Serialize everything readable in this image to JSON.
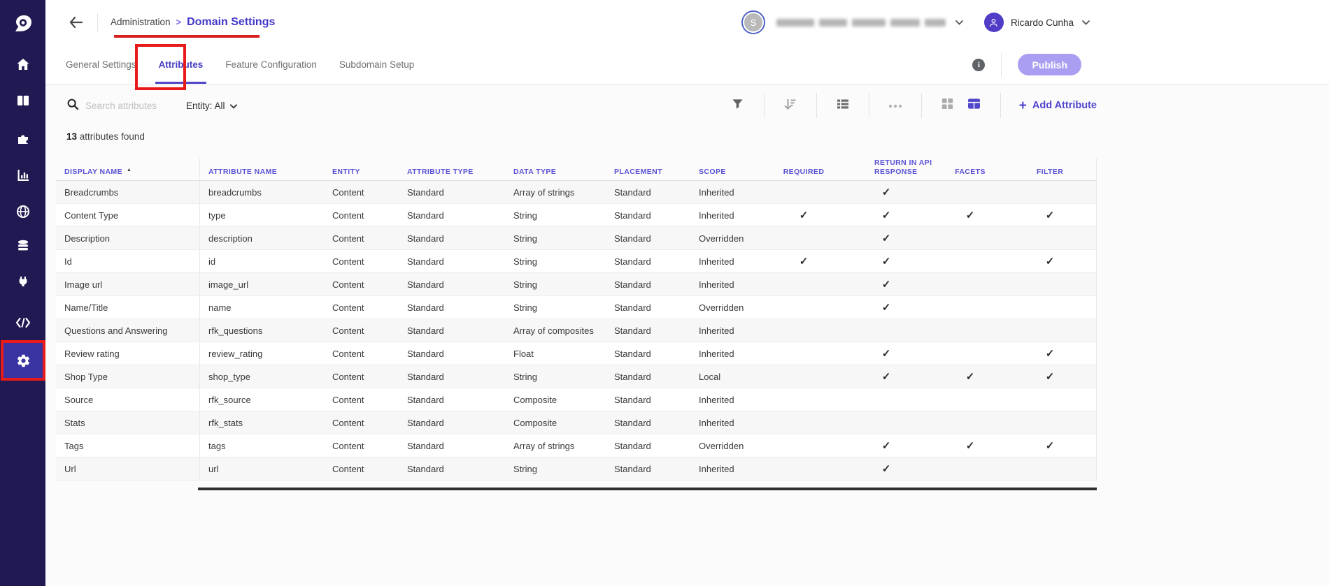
{
  "colors": {
    "accent": "#4f46c8",
    "sidebar_bg": "#211a52",
    "annotation_red": "#e81a1a",
    "publish_bg": "#a99ef2"
  },
  "sidebar": {
    "logo_icon": "discover-logo-icon",
    "item_icons": [
      "home-icon",
      "columns-icon",
      "puzzle-icon",
      "bar-chart-icon",
      "globe-icon",
      "database-icon",
      "plug-icon",
      "code-icon",
      "gear-icon"
    ],
    "active_item": "gear-icon"
  },
  "topbar": {
    "back_icon": "arrow-left-icon",
    "breadcrumb": {
      "parent": "Administration",
      "separator": ">",
      "current": "Domain Settings"
    },
    "workspace": {
      "avatar_initial": "S",
      "name_redacted": true
    },
    "user": {
      "name": "Ricardo Cunha"
    }
  },
  "tabs": {
    "items": [
      {
        "label": "General Settings",
        "active": false
      },
      {
        "label": "Attributes",
        "active": true
      },
      {
        "label": "Feature Configuration",
        "active": false
      },
      {
        "label": "Subdomain Setup",
        "active": false
      }
    ]
  },
  "actions": {
    "info_icon": "i",
    "publish_label": "Publish"
  },
  "toolbar": {
    "search_placeholder": "Search attributes",
    "entity_label": "Entity: All",
    "icons": [
      "filter-funnel-icon",
      "sort-icon",
      "list-view-icon",
      "more-ellipsis-icon",
      "grid-view-icon",
      "table-view-icon"
    ],
    "active_view": "table-view-icon",
    "add_attribute_plus": "+",
    "add_attribute_label": "Add Attribute"
  },
  "summary": {
    "count": "13",
    "label": "attributes found"
  },
  "table": {
    "check_glyph": "✓",
    "sort_arrow": "▲",
    "columns": [
      {
        "key": "display_name",
        "label": "DISPLAY NAME",
        "type": "text",
        "sorted": true
      },
      {
        "key": "attribute_name",
        "label": "ATTRIBUTE NAME",
        "type": "text"
      },
      {
        "key": "entity",
        "label": "ENTITY",
        "type": "text"
      },
      {
        "key": "attribute_type",
        "label": "ATTRIBUTE TYPE",
        "type": "text"
      },
      {
        "key": "data_type",
        "label": "DATA TYPE",
        "type": "text"
      },
      {
        "key": "placement",
        "label": "PLACEMENT",
        "type": "text"
      },
      {
        "key": "scope",
        "label": "SCOPE",
        "type": "text"
      },
      {
        "key": "required",
        "label": "REQUIRED",
        "type": "check"
      },
      {
        "key": "return_in_api_response",
        "label": "RETURN IN API RESPONSE",
        "type": "check"
      },
      {
        "key": "facets",
        "label": "FACETS",
        "type": "check"
      },
      {
        "key": "filter",
        "label": "FILTER",
        "type": "check"
      }
    ],
    "rows": [
      {
        "display_name": "Breadcrumbs",
        "attribute_name": "breadcrumbs",
        "entity": "Content",
        "attribute_type": "Standard",
        "data_type": "Array of strings",
        "placement": "Standard",
        "scope": "Inherited",
        "required": false,
        "return_in_api_response": true,
        "facets": false,
        "filter": false
      },
      {
        "display_name": "Content Type",
        "attribute_name": "type",
        "entity": "Content",
        "attribute_type": "Standard",
        "data_type": "String",
        "placement": "Standard",
        "scope": "Inherited",
        "required": true,
        "return_in_api_response": true,
        "facets": true,
        "filter": true
      },
      {
        "display_name": "Description",
        "attribute_name": "description",
        "entity": "Content",
        "attribute_type": "Standard",
        "data_type": "String",
        "placement": "Standard",
        "scope": "Overridden",
        "required": false,
        "return_in_api_response": true,
        "facets": false,
        "filter": false
      },
      {
        "display_name": "Id",
        "attribute_name": "id",
        "entity": "Content",
        "attribute_type": "Standard",
        "data_type": "String",
        "placement": "Standard",
        "scope": "Inherited",
        "required": true,
        "return_in_api_response": true,
        "facets": false,
        "filter": true
      },
      {
        "display_name": "Image url",
        "attribute_name": "image_url",
        "entity": "Content",
        "attribute_type": "Standard",
        "data_type": "String",
        "placement": "Standard",
        "scope": "Inherited",
        "required": false,
        "return_in_api_response": true,
        "facets": false,
        "filter": false
      },
      {
        "display_name": "Name/Title",
        "attribute_name": "name",
        "entity": "Content",
        "attribute_type": "Standard",
        "data_type": "String",
        "placement": "Standard",
        "scope": "Overridden",
        "required": false,
        "return_in_api_response": true,
        "facets": false,
        "filter": false
      },
      {
        "display_name": "Questions and Answering",
        "attribute_name": "rfk_questions",
        "entity": "Content",
        "attribute_type": "Standard",
        "data_type": "Array of composites",
        "placement": "Standard",
        "scope": "Inherited",
        "required": false,
        "return_in_api_response": false,
        "facets": false,
        "filter": false
      },
      {
        "display_name": "Review rating",
        "attribute_name": "review_rating",
        "entity": "Content",
        "attribute_type": "Standard",
        "data_type": "Float",
        "placement": "Standard",
        "scope": "Inherited",
        "required": false,
        "return_in_api_response": true,
        "facets": false,
        "filter": true
      },
      {
        "display_name": "Shop Type",
        "attribute_name": "shop_type",
        "entity": "Content",
        "attribute_type": "Standard",
        "data_type": "String",
        "placement": "Standard",
        "scope": "Local",
        "required": false,
        "return_in_api_response": true,
        "facets": true,
        "filter": true
      },
      {
        "display_name": "Source",
        "attribute_name": "rfk_source",
        "entity": "Content",
        "attribute_type": "Standard",
        "data_type": "Composite",
        "placement": "Standard",
        "scope": "Inherited",
        "required": false,
        "return_in_api_response": false,
        "facets": false,
        "filter": false
      },
      {
        "display_name": "Stats",
        "attribute_name": "rfk_stats",
        "entity": "Content",
        "attribute_type": "Standard",
        "data_type": "Composite",
        "placement": "Standard",
        "scope": "Inherited",
        "required": false,
        "return_in_api_response": false,
        "facets": false,
        "filter": false
      },
      {
        "display_name": "Tags",
        "attribute_name": "tags",
        "entity": "Content",
        "attribute_type": "Standard",
        "data_type": "Array of strings",
        "placement": "Standard",
        "scope": "Overridden",
        "required": false,
        "return_in_api_response": true,
        "facets": true,
        "filter": true
      },
      {
        "display_name": "Url",
        "attribute_name": "url",
        "entity": "Content",
        "attribute_type": "Standard",
        "data_type": "String",
        "placement": "Standard",
        "scope": "Inherited",
        "required": false,
        "return_in_api_response": true,
        "facets": false,
        "filter": false
      }
    ]
  }
}
